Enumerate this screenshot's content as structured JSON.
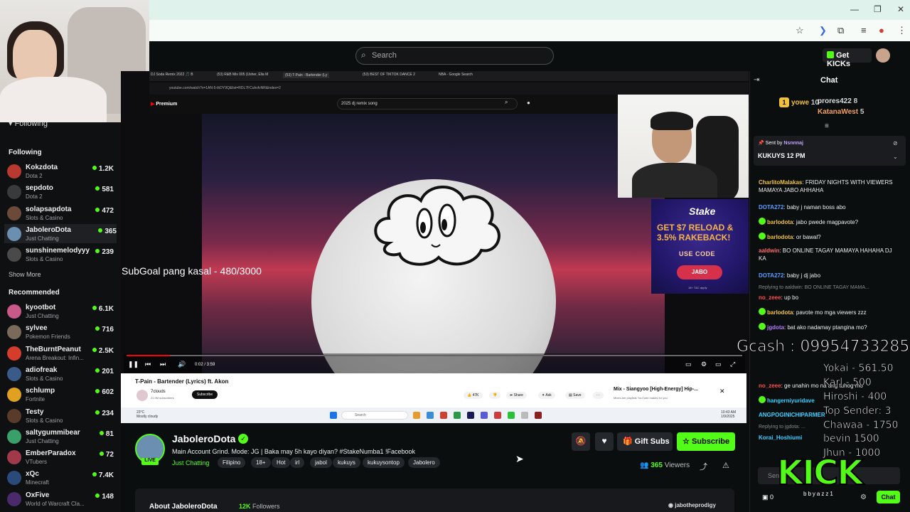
{
  "browser": {
    "window_controls": [
      "—",
      "❐",
      "✕"
    ]
  },
  "header": {
    "search_placeholder": "Search",
    "get_kicks_label": "Get KICKs"
  },
  "sidebar": {
    "following_top": "Following",
    "following_heading": "Following",
    "following": [
      {
        "name": "Kokzdota",
        "category": "Dota 2",
        "viewers": "1.2K",
        "color": "#b8392f"
      },
      {
        "name": "sepdoto",
        "category": "Dota 2",
        "viewers": "581",
        "color": "#3a3a3a"
      },
      {
        "name": "solapsapdota",
        "category": "Slots & Casino",
        "viewers": "472",
        "color": "#6b4a3a"
      },
      {
        "name": "JaboleroDota",
        "category": "Just Chatting",
        "viewers": "365",
        "color": "#6b8fb0"
      },
      {
        "name": "sunshinemelodyyy",
        "category": "Slots & Casino",
        "viewers": "239",
        "color": "#4a4a4a"
      }
    ],
    "show_more": "Show More",
    "recommended_heading": "Recommended",
    "recommended": [
      {
        "name": "kyootbot",
        "category": "Just Chatting",
        "viewers": "6.1K",
        "color": "#c85a8a"
      },
      {
        "name": "sylvee",
        "category": "Pokemon Friends",
        "viewers": "716",
        "color": "#7a6a5a"
      },
      {
        "name": "TheBurntPeanut",
        "category": "Arena Breakout: Infin...",
        "viewers": "2.5K",
        "color": "#d43c2c"
      },
      {
        "name": "adiofreak",
        "category": "Slots & Casino",
        "viewers": "201",
        "color": "#3a5a8a"
      },
      {
        "name": "schlump",
        "category": "Fortnite",
        "viewers": "602",
        "color": "#e0a020"
      },
      {
        "name": "Testy",
        "category": "Slots & Casino",
        "viewers": "234",
        "color": "#5a3a2a"
      },
      {
        "name": "saltygummibear",
        "category": "Just Chatting",
        "viewers": "81",
        "color": "#3aa06a"
      },
      {
        "name": "EmberParadox",
        "category": "VTubers",
        "viewers": "72",
        "color": "#a03a4a"
      },
      {
        "name": "xQc",
        "category": "Minecraft",
        "viewers": "7.4K",
        "color": "#2a4a7a"
      },
      {
        "name": "OxFive",
        "category": "World of Warcraft Cla...",
        "viewers": "148",
        "color": "#4a2a6a"
      }
    ]
  },
  "screen_share": {
    "tabs": [
      "DJ Soda Remix 2022 🎵 B",
      "(53) R&B Mix 005 (Usher, Ella M",
      "(53) T-Pain - Bartender (Ly",
      "(53) BEST OF TIKTOK DANCE 2",
      "NBA - Google Search"
    ],
    "url": "youtube.com/watch?v=1AN-5-thDY9Q&list=RDL7FCuhvfvNR&index=2",
    "yt_logo": "Premium",
    "yt_search": "2025 dj remix song",
    "video_time": "0:02 / 3:59",
    "progress": 0.07,
    "video_title": "T-Pain - Bartender (Lyrics) ft. Akon",
    "channel": "7clouds",
    "channel_subs": "21.9M subscribers",
    "subscribe": "Subscribe",
    "likes": "47K",
    "share": "Share",
    "ask": "Ask",
    "save": "Save",
    "mix_title": "Mix - Siangyoo [High-Energy] Hip-...",
    "mix_sub": "Mixes are playlists YouTube makes for you",
    "taskbar_search": "Search",
    "weather_temp": "23°C",
    "weather_desc": "Mostly cloudy",
    "clock_time": "10:43 AM",
    "clock_date": "1/9/2025"
  },
  "overlay": {
    "subgoal": "SubGoal pang kasal - 480/3000",
    "ad_brand": "Stake",
    "ad_line1": "GET $7 RELOAD &",
    "ad_line2": "3.5% RAKEBACK!",
    "ad_code_label": "USE CODE",
    "ad_code": "JABO",
    "ad_small": "18+ T&C apply",
    "gcash": "Gcash : 09954733285",
    "donors": [
      "Yokai - 561.50",
      "Karl - 500",
      "Hiroshi - 400",
      "Top Sender: 3",
      "Chawaa - 1750",
      "bevin 1500",
      "Jhun - 1000"
    ],
    "kick_logo": "KICK",
    "kick_sub": "bbyazz1"
  },
  "channel": {
    "name": "JaboleroDota",
    "live": "LIVE",
    "title": "Main Account Grind. Mode: JG | Baka may 5h kayo diyan? #StakeNumba1 !Facebook",
    "category": "Just Chatting",
    "tags": [
      "Filipino",
      "18+",
      "Hot",
      "irl",
      "jabol",
      "kukuys",
      "kukuysontop",
      "Jabolero"
    ],
    "gift_subs": "Gift Subs",
    "subscribe": "Subscribe",
    "viewers": "365",
    "viewers_label": "Viewers",
    "about": "About JaboleroDota",
    "followers": "12K",
    "followers_label": "Followers",
    "discord": "jabotheprodigy"
  },
  "chat": {
    "title": "Chat",
    "leaderboard": [
      {
        "name": "yowe",
        "value": "10"
      },
      {
        "name": "prores422",
        "value": "8"
      },
      {
        "name": "KatanaWest",
        "value": "5"
      }
    ],
    "pinned_sent_by": "Sent by",
    "pinned_user": "Nsnnnaj",
    "pinned_msg": "KUKUYS 12 PM",
    "messages": [
      {
        "user": "CharlitoMalakas",
        "color": "#f0c23a",
        "text": "FRIDAY NIGHTS WITH VIEWERS MAMAYA JABO AHHAHA",
        "badge": false
      },
      {
        "user": "DOTA272",
        "color": "#5a9cff",
        "text": "baby j naman boss abo",
        "badge": false
      },
      {
        "user": "barlodota",
        "color": "#f0c23a",
        "text": "jabo pwede magpavote?",
        "badge": true
      },
      {
        "user": "barlodota",
        "color": "#f0c23a",
        "text": "or bawal?",
        "badge": true
      },
      {
        "user": "aaldwin",
        "color": "#ff6b6b",
        "text": "BO ONLINE TAGAY MAMAYA HAHAHA DJ KA",
        "badge": false
      },
      {
        "user": "DOTA272",
        "color": "#5a9cff",
        "text": "baby j dj jabo",
        "badge": false
      },
      {
        "user": "no_zeee",
        "color": "#ff4d4d",
        "text": "up bo",
        "badge": false
      },
      {
        "user": "barlodota",
        "color": "#f0c23a",
        "text": "pavote mo mga viewers zzz",
        "badge": true
      },
      {
        "user": "jgdota",
        "color": "#b37cff",
        "text": "bat ako nadamay ptangina mo?",
        "badge": true
      },
      {
        "user": "no_zeee",
        "color": "#ff4d4d",
        "text": "ge unahin mo na ang tuhog mo",
        "badge": false
      },
      {
        "user": "hangerniyuridave",
        "color": "#3ad0ff",
        "text": "",
        "badge": true
      },
      {
        "user": "ANGPOGINICHIPARMER",
        "color": "#3ad0ff",
        "text": "",
        "badge": false
      },
      {
        "user": "Korai_Hoshiumi",
        "color": "#3ad0ff",
        "text": "",
        "badge": false
      }
    ],
    "reply1": "Replying to aaldwin: BO ONLINE TAGAY MAMA...",
    "reply2": "Replying to jgdota: ...",
    "input_placeholder": "Send",
    "count": "0",
    "send": "Chat"
  }
}
